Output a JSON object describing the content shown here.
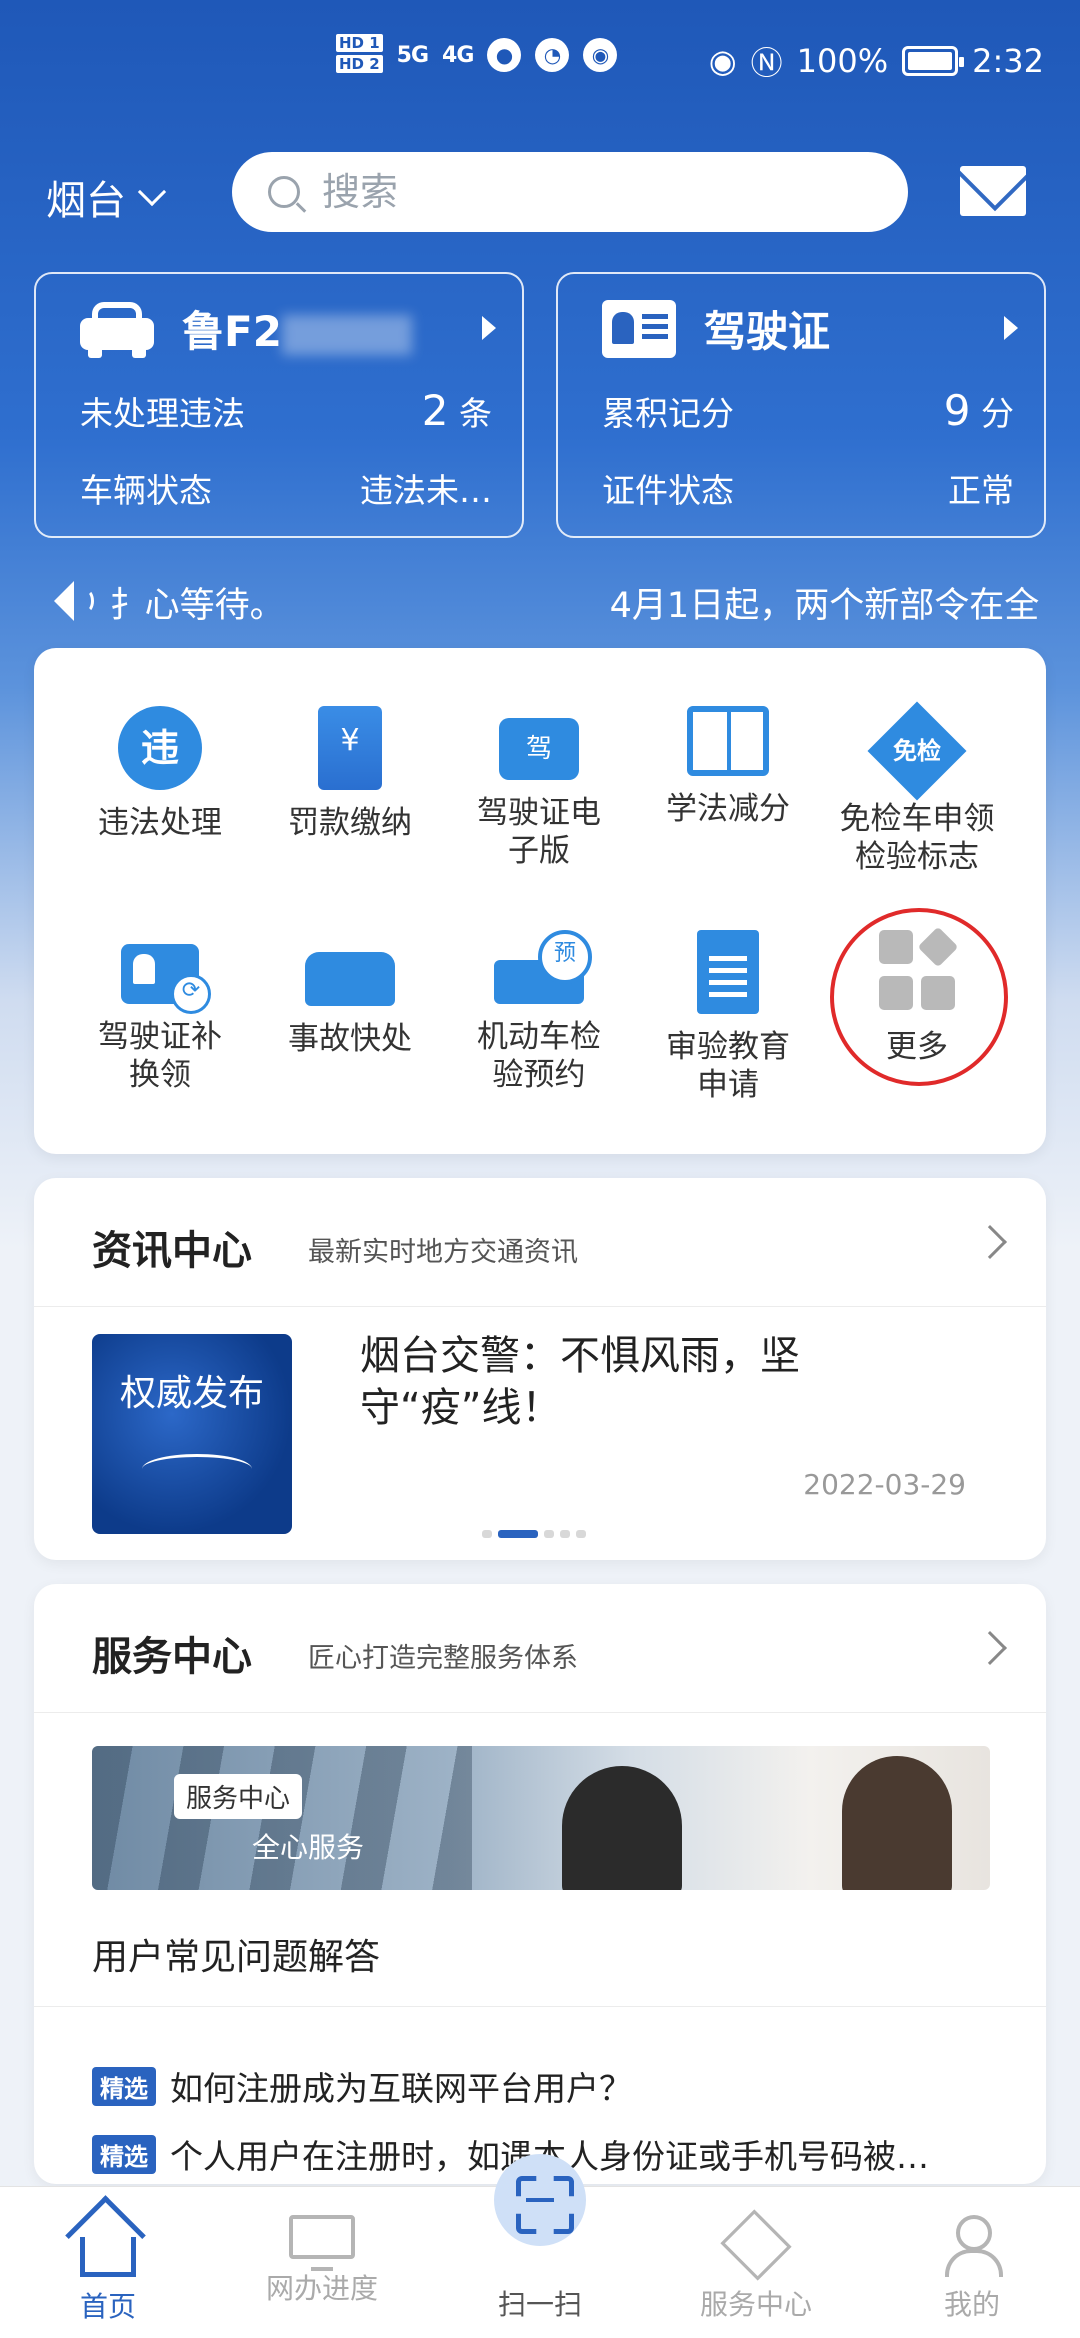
{
  "status_bar": {
    "hd1": "HD 1",
    "hd2": "HD 2",
    "signal1": "5G",
    "signal2": "4G",
    "battery": "100%",
    "time": "2:32"
  },
  "header": {
    "city": "烟台",
    "search_placeholder": "搜索"
  },
  "vehicle_card": {
    "plate": "鲁F2",
    "violation_label": "未处理违法",
    "violation_count": "2",
    "violation_unit": "条",
    "status_label": "车辆状态",
    "status_value": "违法未…"
  },
  "license_card": {
    "title": "驾驶证",
    "points_label": "累积记分",
    "points_value": "9",
    "points_unit": "分",
    "status_label": "证件状态",
    "status_value": "正常"
  },
  "marquee": {
    "text_a": "扌心等待。",
    "text_b": "4月1日起，两个新部令在全"
  },
  "services": [
    {
      "label": "违法处理",
      "icon": "violation-icon",
      "glyph": "违"
    },
    {
      "label": "罚款缴纳",
      "icon": "fine-payment-icon",
      "glyph": "¥"
    },
    {
      "label": "驾驶证电子版",
      "icon": "e-license-icon",
      "glyph": "驾"
    },
    {
      "label": "学法减分",
      "icon": "study-book-icon",
      "glyph": ""
    },
    {
      "label": "免检车申领检验标志",
      "icon": "exempt-inspection-icon",
      "glyph": "免检"
    },
    {
      "label": "驾驶证补换领",
      "icon": "license-replace-icon",
      "glyph": ""
    },
    {
      "label": "事故快处",
      "icon": "accident-icon",
      "glyph": ""
    },
    {
      "label": "机动车检验预约",
      "icon": "inspection-booking-icon",
      "glyph": ""
    },
    {
      "label": "审验教育申请",
      "icon": "education-doc-icon",
      "glyph": ""
    },
    {
      "label": "更多",
      "icon": "more-grid-icon",
      "glyph": ""
    }
  ],
  "news": {
    "title": "资讯中心",
    "subtitle": "最新实时地方交通资讯",
    "image_text": "权威发布",
    "headline": "烟台交警：不惧风雨，坚守“疫”线！",
    "date": "2022-03-29"
  },
  "service_center": {
    "title": "服务中心",
    "subtitle": "匠心打造完整服务体系",
    "banner_tag": "服务中心",
    "banner_sub": "全心服务",
    "faq_title": "用户常见问题解答",
    "faq": [
      {
        "tag": "精选",
        "text": "如何注册成为互联网平台用户？"
      },
      {
        "tag": "精选",
        "text": "个人用户在注册时，如遇本人身份证或手机号码被…"
      }
    ]
  },
  "bottom_nav": [
    {
      "label": "首页",
      "active": true
    },
    {
      "label": "网办进度",
      "active": false
    },
    {
      "label": "扫一扫",
      "active": false
    },
    {
      "label": "服务中心",
      "active": false
    },
    {
      "label": "我的",
      "active": false
    }
  ],
  "colors": {
    "brand_blue": "#2a63bf",
    "icon_blue": "#2f8be0",
    "highlight_red": "#e02a2a"
  }
}
